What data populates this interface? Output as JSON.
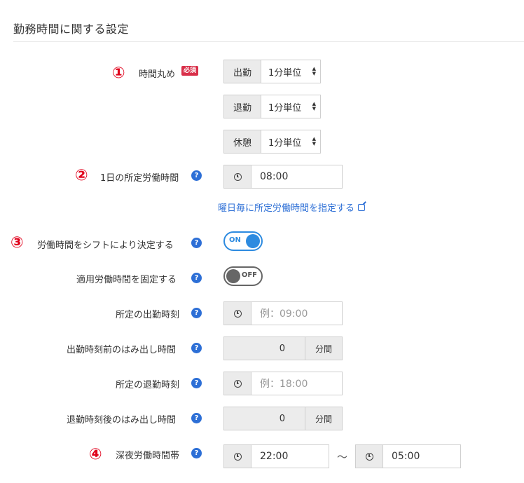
{
  "section_title": "勤務時間に関する設定",
  "badges": {
    "c1": "①",
    "c2": "②",
    "c3": "③",
    "c4": "④"
  },
  "rounding": {
    "label": "時間丸め",
    "required": "必須",
    "rows": [
      {
        "addon": "出勤",
        "value": "1分単位"
      },
      {
        "addon": "退勤",
        "value": "1分単位"
      },
      {
        "addon": "休憩",
        "value": "1分単位"
      }
    ]
  },
  "daily_hours": {
    "label": "1日の所定労働時間",
    "value": "08:00",
    "link": "曜日毎に所定労働時間を指定する"
  },
  "shift_decide": {
    "label": "労働時間をシフトにより決定する",
    "toggle": "ON"
  },
  "fixed_hours": {
    "label": "適用労働時間を固定する",
    "toggle": "OFF"
  },
  "start_time": {
    "label": "所定の出勤時刻",
    "placeholder": "例：09:00"
  },
  "pre_overflow": {
    "label": "出勤時刻前のはみ出し時間",
    "value": "0",
    "unit": "分間"
  },
  "end_time": {
    "label": "所定の退勤時刻",
    "placeholder": "例：18:00"
  },
  "post_overflow": {
    "label": "退勤時刻後のはみ出し時間",
    "value": "0",
    "unit": "分間"
  },
  "night_hours": {
    "label": "深夜労働時間帯",
    "from": "22:00",
    "sep": "～",
    "to": "05:00"
  },
  "help_glyph": "?",
  "arrow_glyphs": {
    "up": "▲",
    "down": "▼"
  }
}
